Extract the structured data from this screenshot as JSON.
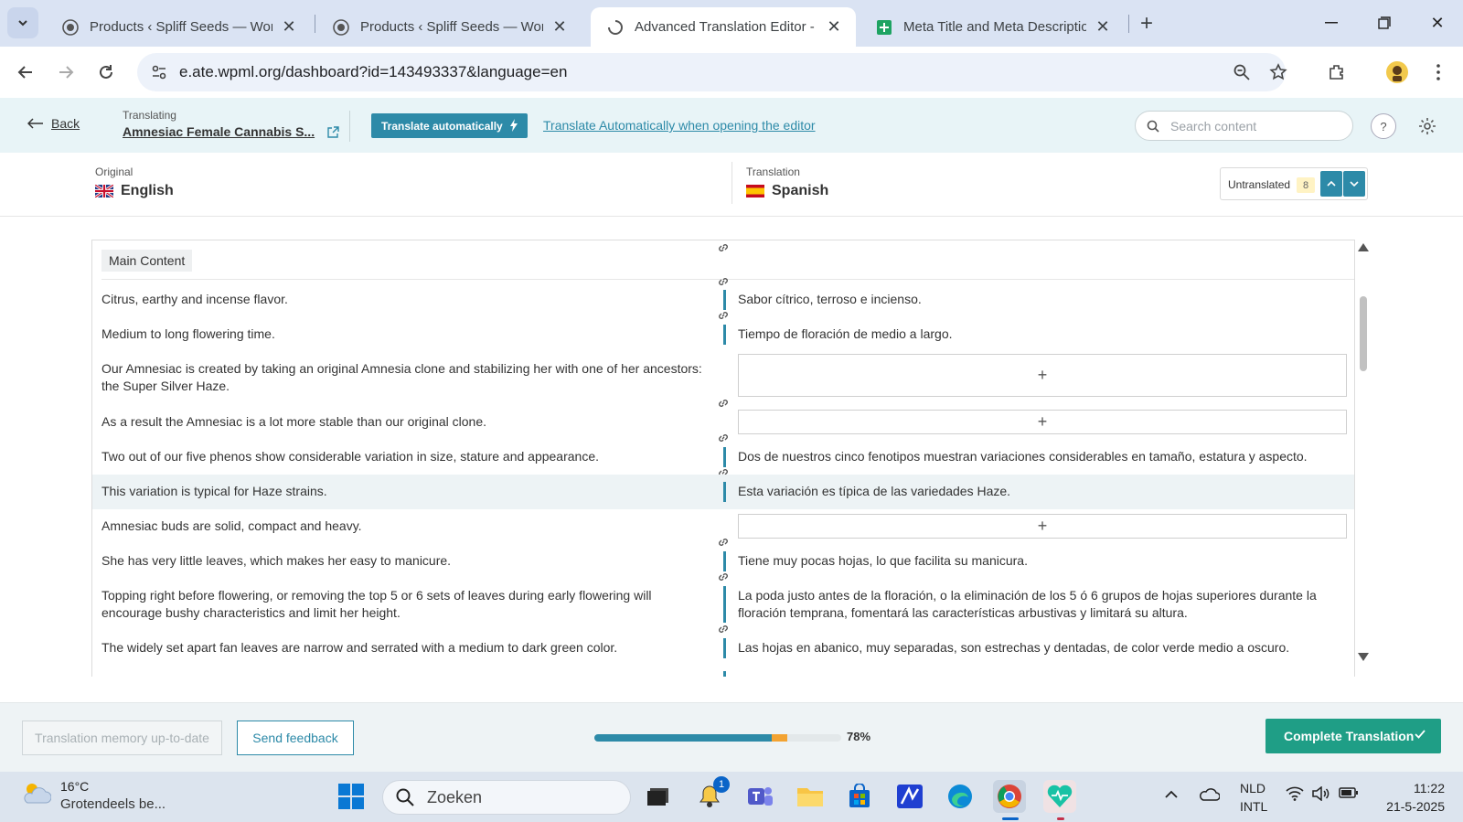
{
  "browser": {
    "tabs": [
      {
        "title": "Products ‹ Spliff Seeds — WordPress",
        "active": false
      },
      {
        "title": "Products ‹ Spliff Seeds — WordPress",
        "active": false
      },
      {
        "title": "Advanced Translation Editor - WPML",
        "active": true
      },
      {
        "title": "Meta Title and Meta Description",
        "active": false
      }
    ],
    "url": "e.ate.wpml.org/dashboard?id=143493337&language=en"
  },
  "header": {
    "back_label": "Back",
    "translating_label": "Translating",
    "document_title": "Amnesiac Female Cannabis S...",
    "auto_button": "Translate automatically",
    "auto_link": "Translate Automatically when opening the editor",
    "search_placeholder": "Search content"
  },
  "languages": {
    "original_label": "Original",
    "original_name": "English",
    "translation_label": "Translation",
    "translation_name": "Spanish",
    "untranslated_label": "Untranslated",
    "untranslated_count": "8"
  },
  "editor": {
    "section": "Main Content",
    "rows": [
      {
        "source": "Citrus, earthy and incense flavor.",
        "target": "Sabor cítrico, terroso e incienso."
      },
      {
        "source": "Medium to long flowering time.",
        "target": "Tiempo de floración de medio a largo."
      },
      {
        "source": "Our Amnesiac is created by taking an original Amnesia clone and stabilizing her with one of her ancestors: the Super Silver Haze.",
        "target": "+"
      },
      {
        "source": "As a result the Amnesiac is a lot more stable than our original clone.",
        "target": "+"
      },
      {
        "source": "Two out of our five phenos show considerable variation in size, stature and appearance.",
        "target": "Dos de nuestros cinco fenotipos muestran variaciones considerables en tamaño, estatura y aspecto."
      },
      {
        "source": "This variation is typical for Haze strains.",
        "target": "Esta variación es típica de las variedades Haze."
      },
      {
        "source": "Amnesiac buds are solid, compact and heavy.",
        "target": "+"
      },
      {
        "source": "She has very little leaves, which makes her easy to manicure.",
        "target": "Tiene muy pocas hojas, lo que facilita su manicura."
      },
      {
        "source": "Topping right before flowering, or removing the top 5 or 6 sets of leaves during early flowering will encourage bushy characteristics and limit her height.",
        "target": "La poda justo antes de la floración, o la eliminación de los 5 ó 6 grupos de hojas superiores durante la floración temprana, fomentará las características arbustivas y limitará su altura."
      },
      {
        "source": "The widely set apart fan leaves are narrow and serrated with a medium to dark green color.",
        "target": "Las hojas en abanico, muy separadas, son estrechas y dentadas, de color verde medio a oscuro."
      }
    ]
  },
  "footer": {
    "tm_label": "Translation memory up-to-date",
    "feedback_label": "Send feedback",
    "progress": 78,
    "progress_label": "78%",
    "complete_label": "Complete Translation"
  },
  "taskbar": {
    "temperature": "16°C",
    "weather": "Grotendeels be...",
    "search": "Zoeken",
    "lang_1": "NLD",
    "lang_2": "INTL",
    "time": "11:22",
    "date": "21-5-2025",
    "notification_count": "1"
  },
  "colors": {
    "accent": "#2d8aa8",
    "complete": "#1f9e86",
    "progress_secondary": "#f3a332"
  }
}
